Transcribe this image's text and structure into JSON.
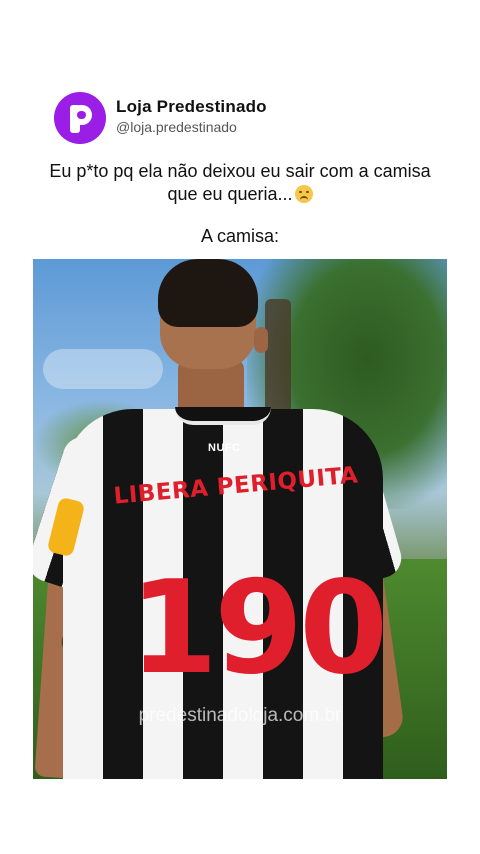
{
  "profile": {
    "name": "Loja Predestinado",
    "handle": "@loja.predestinado"
  },
  "post": {
    "caption": "Eu p*to pq ela não deixou eu sair com a camisa que eu queria...",
    "emoji_name": "disappointed-face-emoji",
    "subtitle": "A camisa:"
  },
  "photo": {
    "shirt_badge": "NUFC",
    "shirt_name": "LIBERA PERIQUITA",
    "shirt_number": "190",
    "watermark": "predestinadoloja.com.br"
  },
  "colors": {
    "avatar": "#9b1ee6",
    "shirt_print": "#e01f2c"
  }
}
